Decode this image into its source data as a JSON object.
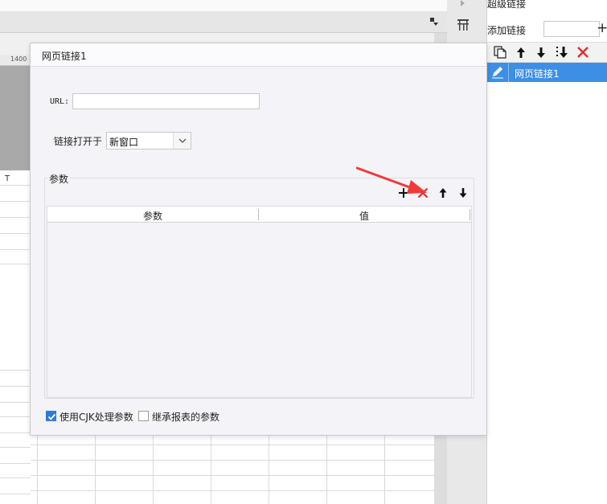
{
  "ruler": {
    "mark": "1400"
  },
  "sheet": {
    "column_letter": "T"
  },
  "right_panel": {
    "title": "超级链接",
    "add_label": "添加链接",
    "add_plus": "+",
    "links": [
      {
        "label": "网页链接1"
      }
    ]
  },
  "dialog": {
    "title": "网页链接1",
    "url_label": "URL:",
    "url_value": "",
    "open_label": "链接打开于",
    "open_value": "新窗口",
    "params_legend": "参数",
    "table_headers": [
      "参数",
      "值"
    ],
    "use_cjk_label": "使用CJK处理参数",
    "use_cjk_checked": true,
    "inherit_label": "继承报表的参数",
    "inherit_checked": false
  },
  "colors": {
    "accent": "#3d8fe6",
    "delete_red": "#e02b2b",
    "annotation_arrow": "#f03a3a"
  }
}
